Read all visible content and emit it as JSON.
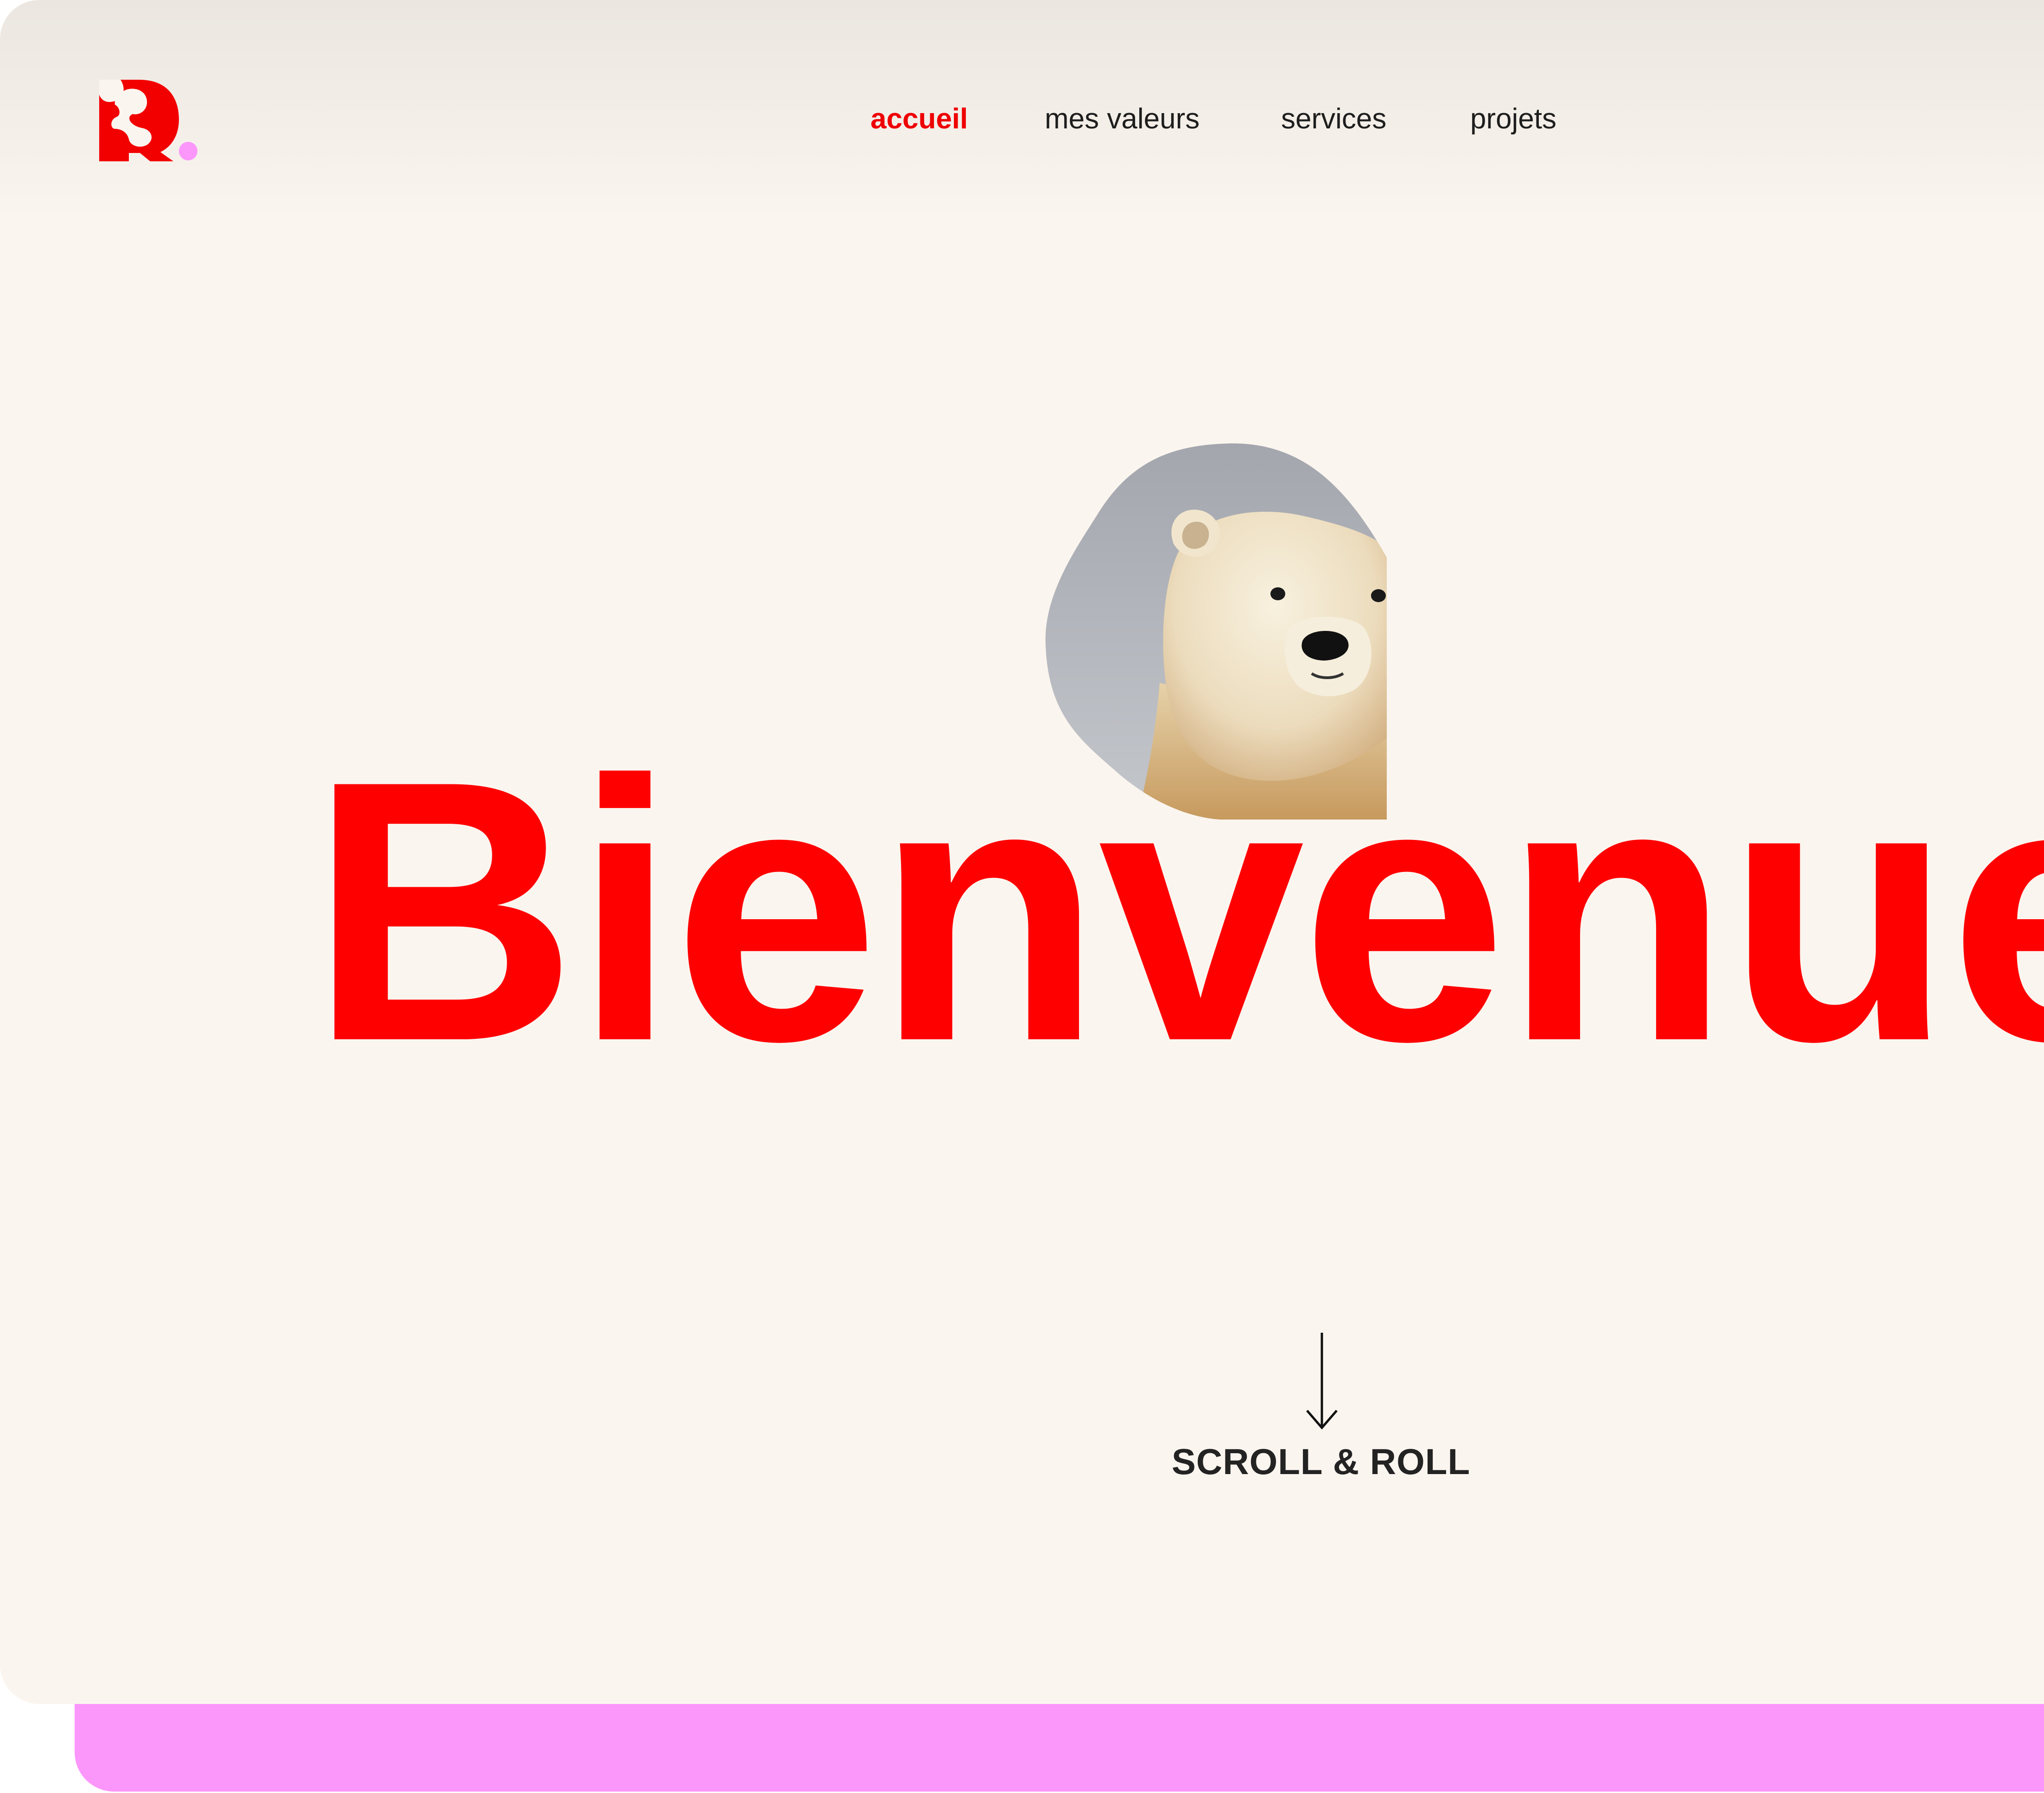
{
  "brand": {
    "logo_icon": "r-dot-logo-icon",
    "primary_color": "#ff0000",
    "accent_color": "#fb96fb",
    "background_color": "#fbf5ef"
  },
  "nav": {
    "items": [
      {
        "label": "accueil",
        "active": true
      },
      {
        "label": "mes valeurs",
        "active": false
      },
      {
        "label": "services",
        "active": false
      },
      {
        "label": "projets",
        "active": false
      }
    ]
  },
  "hero": {
    "title": "Bienvenue",
    "image": "polar-bear-photo"
  },
  "scroll_cta": {
    "icon": "arrow-down-icon",
    "label": "SCROLL & ROLL"
  }
}
